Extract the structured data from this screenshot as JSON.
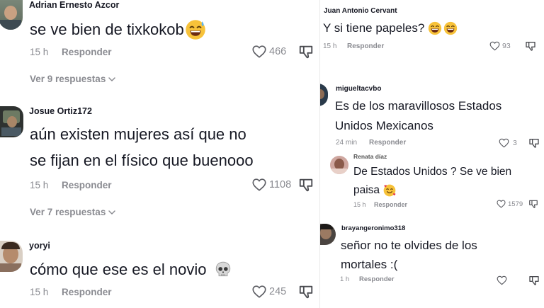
{
  "left": {
    "comments": [
      {
        "user": "Adrian Ernesto Azcor",
        "text": "se ve bien de tixkokob",
        "time": "15 h",
        "reply": "Responder",
        "likes": "466",
        "emoji": "sweat-smile",
        "view_more": "Ver 9 respuestas"
      },
      {
        "user": "Josue Ortiz172",
        "text_line1": "aún existen mujeres así que no",
        "text_line2": "se fijan en el físico que buenooo",
        "time": "15 h",
        "reply": "Responder",
        "likes": "1108",
        "view_more": "Ver 7 respuestas"
      },
      {
        "user": "yoryi",
        "text": "cómo que ese es el novio",
        "time": "15 h",
        "reply": "Responder",
        "likes": "245",
        "emoji": "skull"
      }
    ]
  },
  "right": {
    "comments": [
      {
        "user": "Juan Antonio Cervant",
        "text": "Y si tiene papeles?",
        "time": "15 h",
        "reply": "Responder",
        "likes": "93"
      },
      {
        "user": "migueltacvbo",
        "text_line1": "Es de los maravillosos Estados",
        "text_line2": "Unidos Mexicanos",
        "time": "24 min",
        "reply": "Responder",
        "likes": "3"
      },
      {
        "user": "Renata díaz",
        "text_line1": "De Estados Unidos ? Se ve bien",
        "text_line2": "paisa",
        "time": "15 h",
        "reply": "Responder",
        "likes": "1579"
      },
      {
        "user": "brayangeronimo318",
        "text_line1": "señor no te olvides de los",
        "text_line2": "mortales :(",
        "time": "1 h",
        "reply": "Responder",
        "likes": ""
      }
    ]
  }
}
